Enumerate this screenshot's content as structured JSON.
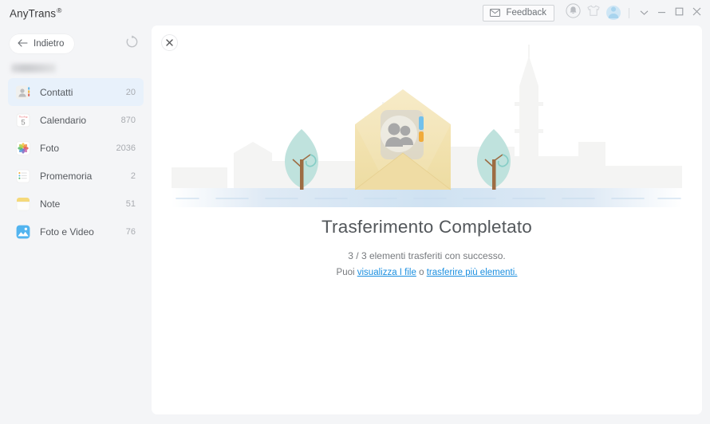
{
  "window": {
    "title": "AnyTrans",
    "title_mark": "®"
  },
  "titlebar": {
    "feedback_label": "Feedback",
    "feedback_icon": "envelope-icon",
    "notifications_icon": "bell-icon",
    "themes_icon": "tshirt-icon",
    "account_icon": "avatar-icon",
    "more_icon": "chevron-down-icon",
    "minimize_icon": "minimize-icon",
    "maximize_icon": "maximize-icon",
    "close_icon": "close-icon"
  },
  "sidebar": {
    "back_label": "Indietro",
    "back_icon": "arrow-left-icon",
    "refresh_icon": "refresh-icon",
    "device_name": "",
    "items": [
      {
        "label": "Contatti",
        "count": "20",
        "icon": "contacts-icon",
        "selected": true
      },
      {
        "label": "Calendario",
        "count": "870",
        "icon": "calendar-icon",
        "selected": false
      },
      {
        "label": "Foto",
        "count": "2036",
        "icon": "photos-icon",
        "selected": false
      },
      {
        "label": "Promemoria",
        "count": "2",
        "icon": "reminders-icon",
        "selected": false
      },
      {
        "label": "Note",
        "count": "51",
        "icon": "notes-icon",
        "selected": false
      },
      {
        "label": "Foto e Video",
        "count": "76",
        "icon": "photos-videos-icon",
        "selected": false
      }
    ]
  },
  "main": {
    "close_icon": "close-icon",
    "illustration": "envelope-contacts-city-illustration",
    "headline": "Trasferimento Completato",
    "subtitle": "3 / 3 elementi trasferiti con successo.",
    "link_prefix": "Puoi ",
    "link_view": "visualizza I file",
    "link_middle": " o ",
    "link_transfer": "trasferire più elementi.",
    "progress": {
      "done": 3,
      "total": 3
    }
  },
  "colors": {
    "accent_link": "#1b8fe0",
    "selected_row": "#e8f1fb",
    "chrome_bg": "#f4f5f7",
    "panel_bg": "#ffffff",
    "envelope": "#f0dda8",
    "tree": "#b9e0dc"
  }
}
